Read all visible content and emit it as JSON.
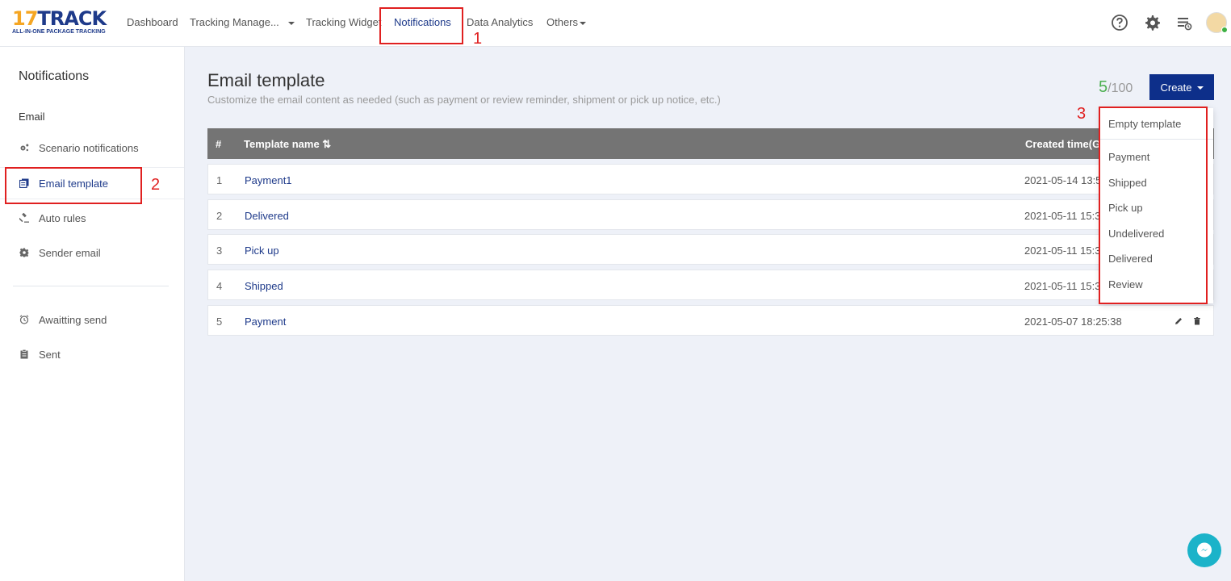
{
  "brand": {
    "logo_number": "17",
    "logo_text": "TRACK",
    "tagline": "ALL-IN-ONE PACKAGE TRACKING"
  },
  "nav": {
    "dashboard": "Dashboard",
    "tracking_management": "Tracking Manage...",
    "tracking_widget": "Tracking Widget",
    "notifications": "Notifications",
    "data_analytics": "Data Analytics",
    "others": "Others"
  },
  "header_icons": [
    "help-icon",
    "gear-icon",
    "task-list-icon",
    "avatar"
  ],
  "annotations": {
    "one": "1",
    "two": "2",
    "three": "3"
  },
  "sidebar": {
    "title": "Notifications",
    "section_email": "Email",
    "items": [
      {
        "label": "Scenario notifications",
        "icon": "scenario-icon"
      },
      {
        "label": "Email template",
        "icon": "template-icon"
      },
      {
        "label": "Auto rules",
        "icon": "gavel-icon"
      },
      {
        "label": "Sender email",
        "icon": "gear-icon"
      },
      {
        "label": "Awaitting send",
        "icon": "clock-icon"
      },
      {
        "label": "Sent",
        "icon": "clipboard-icon"
      }
    ]
  },
  "main": {
    "title": "Email template",
    "subtitle": "Customize the email content as needed (such as payment or review reminder, shipment or pick up notice, etc.)",
    "count_used": "5",
    "count_total": "/100",
    "create_label": "Create"
  },
  "table": {
    "headers": {
      "index": "#",
      "name": "Template name ⇅",
      "created": "Created time(GM"
    },
    "rows": [
      {
        "index": "1",
        "name": "Payment1",
        "created": "2021-05-14 13:5"
      },
      {
        "index": "2",
        "name": "Delivered",
        "created": "2021-05-11 15:3"
      },
      {
        "index": "3",
        "name": "Pick up",
        "created": "2021-05-11 15:3"
      },
      {
        "index": "4",
        "name": "Shipped",
        "created": "2021-05-11 15:3"
      },
      {
        "index": "5",
        "name": "Payment",
        "created": "2021-05-07 18:25:38"
      }
    ]
  },
  "dropdown": {
    "items": [
      "Empty template",
      "Payment",
      "Shipped",
      "Pick up",
      "Undelivered",
      "Delivered",
      "Review"
    ]
  },
  "colors": {
    "brand_blue": "#0d2f8a",
    "accent_orange": "#f5a623",
    "count_green": "#4caf50",
    "annotation_red": "#e02020",
    "chat_teal": "#1bb3c9"
  }
}
